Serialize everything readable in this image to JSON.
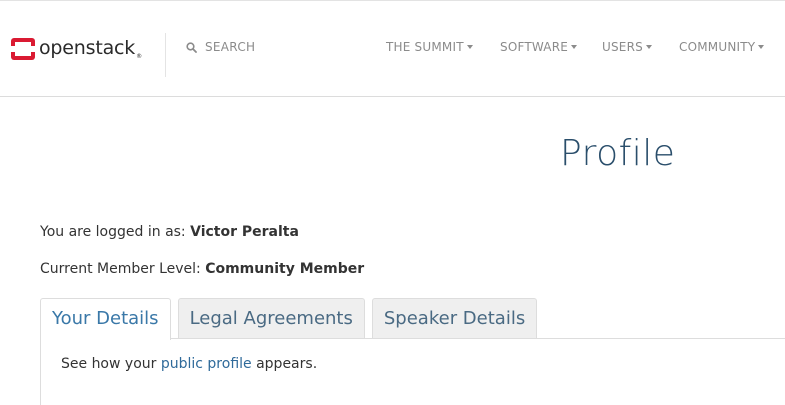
{
  "header": {
    "logo_text": "openstack",
    "logo_mark": "®",
    "brand_color": "#da1a32",
    "search_label": "SEARCH",
    "nav": [
      {
        "label": "THE SUMMIT"
      },
      {
        "label": "SOFTWARE"
      },
      {
        "label": "USERS"
      },
      {
        "label": "COMMUNITY"
      }
    ]
  },
  "page": {
    "title": "Profile",
    "logged_in_prefix": "You are logged in as:",
    "user_name": "Victor Peralta",
    "member_level_prefix": "Current Member Level:",
    "member_level": "Community Member"
  },
  "tabs": [
    {
      "label": "Your Details",
      "active": true
    },
    {
      "label": "Legal Agreements",
      "active": false
    },
    {
      "label": "Speaker Details",
      "active": false
    }
  ],
  "panel": {
    "text_before": "See how your",
    "link_text": "public profile",
    "text_after": "appears."
  }
}
